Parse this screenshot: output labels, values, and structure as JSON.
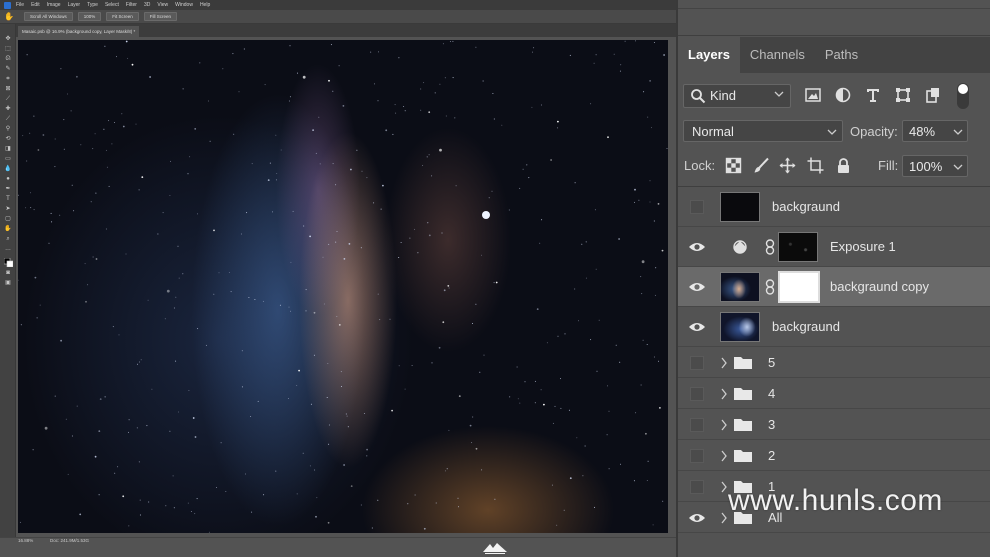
{
  "menubar": {
    "items": [
      "File",
      "Edit",
      "Image",
      "Layer",
      "Type",
      "Select",
      "Filter",
      "3D",
      "View",
      "Window",
      "Help"
    ]
  },
  "optionsbar": {
    "buttons": [
      "Scroll All Windows",
      "100%",
      "Fit Screen",
      "Fill Screen"
    ]
  },
  "document": {
    "tab_title": "Masaic.psb @ 16.9% (background copy, Layer Mask/8) *"
  },
  "status": {
    "zoom": "16.88%",
    "doc": "Doc: 241.9M/1.53G"
  },
  "panel": {
    "tabs": [
      "Layers",
      "Channels",
      "Paths"
    ],
    "filter": {
      "kind_label": "Kind"
    },
    "blend": {
      "mode": "Normal",
      "opacity_label": "Opacity:",
      "opacity_value": "48%"
    },
    "lock": {
      "label": "Lock:",
      "fill_label": "Fill:",
      "fill_value": "100%"
    },
    "layers": [
      {
        "name": "backgraund",
        "visible": false,
        "type": "pixel"
      },
      {
        "name": "Exposure 1",
        "visible": true,
        "type": "adjustment"
      },
      {
        "name": "backgraund copy",
        "visible": true,
        "type": "masked",
        "selected": true
      },
      {
        "name": "backgraund",
        "visible": true,
        "type": "pixel"
      }
    ],
    "groups": [
      {
        "name": "5",
        "visible": false
      },
      {
        "name": "4",
        "visible": false
      },
      {
        "name": "3",
        "visible": false
      },
      {
        "name": "2",
        "visible": false
      },
      {
        "name": "1",
        "visible": false
      },
      {
        "name": "All",
        "visible": true
      }
    ]
  },
  "watermark": "www.hunls.com",
  "colors": {
    "panel_bg": "#535353",
    "tab_bar_bg": "#434343",
    "selected_layer_bg": "#6a6a6a",
    "canvas_bg": "#0b0d16"
  }
}
